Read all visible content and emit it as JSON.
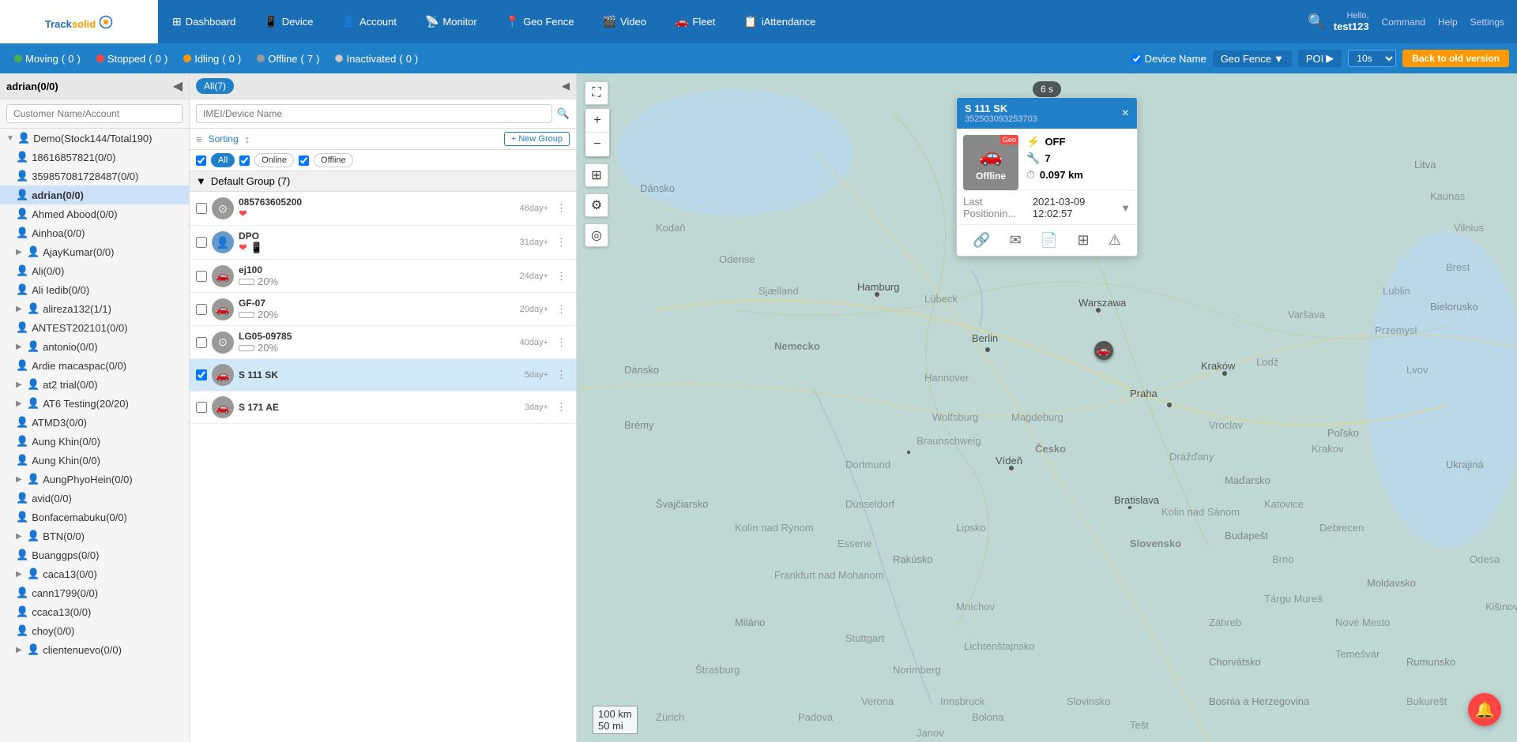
{
  "app": {
    "name": "Tracksolid",
    "logo_text": "Track",
    "logo_dot": "solid"
  },
  "nav": {
    "items": [
      {
        "id": "dashboard",
        "icon": "⊞",
        "label": "Dashboard"
      },
      {
        "id": "device",
        "icon": "📱",
        "label": "Device"
      },
      {
        "id": "account",
        "icon": "👤",
        "label": "Account"
      },
      {
        "id": "monitor",
        "icon": "📡",
        "label": "Monitor"
      },
      {
        "id": "geofence",
        "icon": "📍",
        "label": "Geo Fence"
      },
      {
        "id": "video",
        "icon": "🎬",
        "label": "Video"
      },
      {
        "id": "fleet",
        "icon": "🚗",
        "label": "Fleet"
      },
      {
        "id": "iattendance",
        "icon": "📋",
        "label": "iAttendance"
      }
    ],
    "hello": "Hello,",
    "username": "test123",
    "command": "Command",
    "help": "Help",
    "settings": "Settings"
  },
  "second_bar": {
    "moving": {
      "label": "Moving",
      "count": 0
    },
    "stopped": {
      "label": "Stopped",
      "count": 0
    },
    "idling": {
      "label": "Idling",
      "count": 0
    },
    "offline": {
      "label": "Offline",
      "count": 7
    },
    "inactivated": {
      "label": "Inactivated",
      "count": 0
    },
    "device_name_cb": "Device Name",
    "geo_fence_label": "Geo Fence",
    "poi_label": "POI",
    "interval": "10s",
    "back_old_version": "Back to old version"
  },
  "sidebar": {
    "title": "adrian(0/0)",
    "search_placeholder": "Customer Name/Account",
    "items": [
      {
        "id": "demo",
        "label": "Demo(Stock144/Total190)",
        "level": 0,
        "type": "folder",
        "has_arrow": true,
        "icon": "orange",
        "expanded": true
      },
      {
        "id": "user1",
        "label": "18616857821(0/0)",
        "level": 1,
        "type": "user",
        "icon": "orange"
      },
      {
        "id": "user2",
        "label": "35985708172848​7(0/0)",
        "level": 1,
        "type": "user",
        "icon": "orange"
      },
      {
        "id": "adrian",
        "label": "adrian(0/0)",
        "level": 1,
        "type": "user",
        "icon": "blue",
        "highlighted": true
      },
      {
        "id": "ahmed",
        "label": "Ahmed Abood(0/0)",
        "level": 1,
        "type": "user",
        "icon": "orange"
      },
      {
        "id": "ainhoa",
        "label": "Ainhoa(0/0)",
        "level": 1,
        "type": "user",
        "icon": "orange"
      },
      {
        "id": "ajay",
        "label": "AjayKumar(0/0)",
        "level": 1,
        "type": "user",
        "icon": "orange",
        "has_arrow": true
      },
      {
        "id": "ali",
        "label": "Ali(0/0)",
        "level": 1,
        "type": "user",
        "icon": "orange"
      },
      {
        "id": "ali2",
        "label": "Ali Iedib(0/0)",
        "level": 1,
        "type": "user",
        "icon": "orange"
      },
      {
        "id": "alireza",
        "label": "alireza132(1/1)",
        "level": 1,
        "type": "user",
        "icon": "orange",
        "has_arrow": true
      },
      {
        "id": "antest",
        "label": "ANTEST202101(0/0)",
        "level": 1,
        "type": "user",
        "icon": "orange"
      },
      {
        "id": "antonio",
        "label": "antonio(0/0)",
        "level": 1,
        "type": "user",
        "icon": "orange",
        "has_arrow": true
      },
      {
        "id": "ardie",
        "label": "Ardie macaspac(0/0)",
        "level": 1,
        "type": "user",
        "icon": "orange"
      },
      {
        "id": "at2",
        "label": "at2 trial(0/0)",
        "level": 1,
        "type": "user",
        "icon": "orange",
        "has_arrow": true
      },
      {
        "id": "at6",
        "label": "AT6 Testing(20/20)",
        "level": 1,
        "type": "user",
        "icon": "orange",
        "has_arrow": true
      },
      {
        "id": "atmd3",
        "label": "ATMD3(0/0)",
        "level": 1,
        "type": "user",
        "icon": "orange"
      },
      {
        "id": "aungkhin1",
        "label": "Aung Khin(0/0)",
        "level": 1,
        "type": "user",
        "icon": "orange"
      },
      {
        "id": "aungkhin2",
        "label": "Aung Khin(0/0)",
        "level": 1,
        "type": "user",
        "icon": "orange"
      },
      {
        "id": "aungphyo",
        "label": "AungPhyoHein(0/0)",
        "level": 1,
        "type": "user",
        "icon": "orange",
        "has_arrow": true
      },
      {
        "id": "avid",
        "label": "avid(0/0)",
        "level": 1,
        "type": "user",
        "icon": "orange"
      },
      {
        "id": "bonface",
        "label": "Bonfacemabuku(0/0)",
        "level": 1,
        "type": "user",
        "icon": "orange"
      },
      {
        "id": "btn",
        "label": "BTN(0/0)",
        "level": 1,
        "type": "user",
        "icon": "orange",
        "has_arrow": true
      },
      {
        "id": "buang",
        "label": "Buanggps(0/0)",
        "level": 1,
        "type": "user",
        "icon": "orange"
      },
      {
        "id": "caca13",
        "label": "caca13(0/0)",
        "level": 1,
        "type": "user",
        "icon": "orange",
        "has_arrow": true
      },
      {
        "id": "cann1799",
        "label": "cann1799(0/0)",
        "level": 1,
        "type": "user",
        "icon": "orange"
      },
      {
        "id": "ccaca13",
        "label": "ccaca13(0/0)",
        "level": 1,
        "type": "user",
        "icon": "orange"
      },
      {
        "id": "choy",
        "label": "choy(0/0)",
        "level": 1,
        "type": "user",
        "icon": "orange"
      },
      {
        "id": "cliente",
        "label": "clientenuevo(0/0)",
        "level": 1,
        "type": "user",
        "icon": "orange",
        "has_arrow": true
      }
    ]
  },
  "middle": {
    "all_badge": "All(7)",
    "search_placeholder": "IMEI/Device Name",
    "sorting_label": "Sorting",
    "new_group_label": "+ New Group",
    "filters": {
      "all": "All",
      "online": "Online",
      "offline": "Offline"
    },
    "group": {
      "name": "Default Group (7)",
      "collapsed": false
    },
    "devices": [
      {
        "id": "d1",
        "name": "085763605200",
        "icon": "circle",
        "status": "offline",
        "age": "46day+",
        "sub": "",
        "battery": null,
        "selected": false
      },
      {
        "id": "d2",
        "name": "DPO",
        "icon": "person",
        "status": "offline",
        "age": "31day+",
        "sub": "heart+phone",
        "battery": null,
        "selected": false
      },
      {
        "id": "d3",
        "name": "ej100",
        "icon": "car",
        "status": "offline",
        "age": "24day+",
        "sub": "battery20",
        "battery": 20,
        "selected": false
      },
      {
        "id": "d4",
        "name": "GF-07",
        "icon": "car",
        "status": "offline",
        "age": "20day+",
        "sub": "battery20",
        "battery": 20,
        "selected": false
      },
      {
        "id": "d5",
        "name": "LG05-09785",
        "icon": "circle",
        "status": "offline",
        "age": "40day+",
        "sub": "battery20",
        "battery": 20,
        "selected": false
      },
      {
        "id": "d6",
        "name": "S 111 SK",
        "icon": "car",
        "status": "offline",
        "age": "5day+",
        "sub": "",
        "battery": null,
        "selected": true
      },
      {
        "id": "d7",
        "name": "S 171 AE",
        "icon": "car",
        "status": "offline",
        "age": "3day+",
        "sub": "",
        "battery": null,
        "selected": false
      }
    ]
  },
  "popup": {
    "title": "S 111 SK",
    "imei": "352503093253703",
    "status": "Offline",
    "geo_label": "Geo",
    "acc_label": "OFF",
    "relay_count": "7",
    "mileage": "0.097 km",
    "last_position_label": "Last Positionin...",
    "last_position_date": "2021-03-09 12:02:57",
    "close": "×",
    "expand": "▼"
  },
  "map": {
    "timer": "6 s",
    "scale_km": "100 km",
    "scale_mi": "50 mi"
  }
}
